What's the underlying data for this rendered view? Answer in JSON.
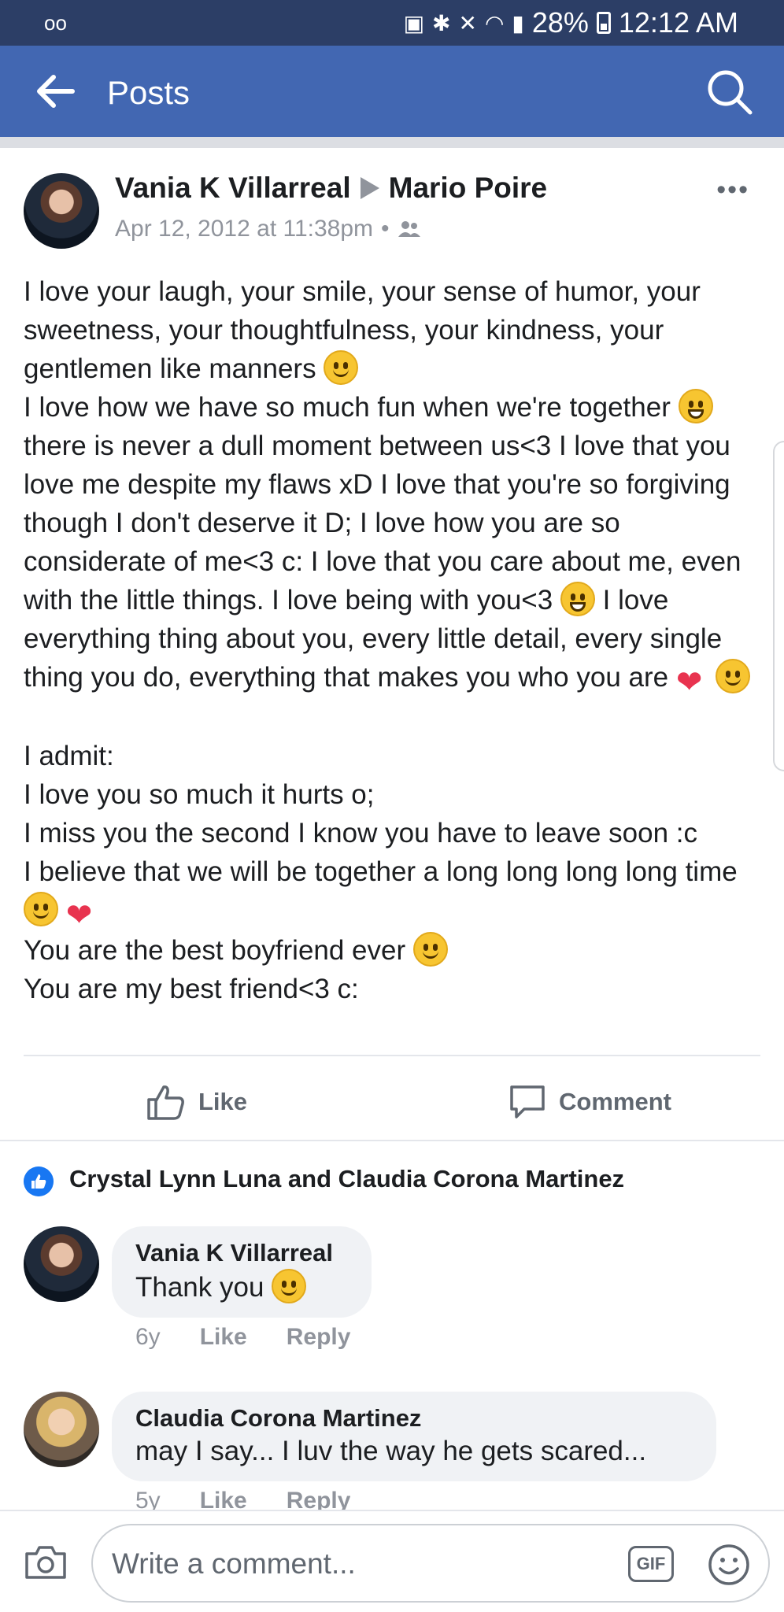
{
  "status_bar": {
    "voicemail": "oo",
    "battery_percent": "28%",
    "time": "12:12 AM"
  },
  "app_bar": {
    "title": "Posts"
  },
  "post": {
    "author": "Vania K Villarreal",
    "recipient": "Mario Poire",
    "timestamp": "Apr 12, 2012 at 11:38pm",
    "separator": "•",
    "body_lines": [
      "I love your laugh, your smile, your sense of humor, your sweetness, your thoughtfulness, your kindness, your gentlemen like manners",
      "I love how we have so much fun when we're together",
      "there is never a dull moment between us<3 I love that you love me despite my flaws xD I love that you're so forgiving though I don't deserve it D; I love how you are so considerate of me<3 c: I love that you care about me, even with the little things. I love being with you<3",
      "I love everything thing about you, every little detail, every single thing you do, everything that makes you who you are",
      "I admit:",
      "I love you so much it hurts o;",
      "I miss you the second I know you have to leave soon :c",
      "I believe that we will be together a long long long long time",
      "You are the best boyfriend ever",
      "You are my best friend<3 c:"
    ]
  },
  "actions": {
    "like": "Like",
    "comment": "Comment"
  },
  "reactions": {
    "names": "Crystal Lynn Luna and Claudia Corona Martinez"
  },
  "comments": [
    {
      "author": "Vania K Villarreal",
      "text": "Thank you",
      "age": "6y",
      "like": "Like",
      "reply": "Reply"
    },
    {
      "author": "Claudia Corona Martinez",
      "text": "may I say... I luv the way he gets scared...",
      "age": "5y",
      "like": "Like",
      "reply": "Reply"
    }
  ],
  "composer": {
    "placeholder": "Write a comment...",
    "gif_label": "GIF"
  }
}
